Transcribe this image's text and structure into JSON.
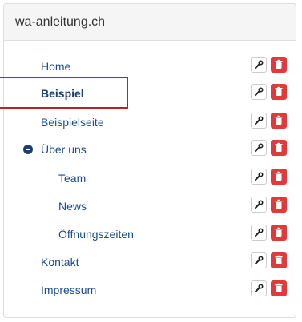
{
  "panel": {
    "title": "wa-anleitung.ch"
  },
  "pages": [
    {
      "label": "Home",
      "level": 1,
      "active": false
    },
    {
      "label": "Beispiel",
      "level": 1,
      "active": true
    },
    {
      "label": "Beispielseite",
      "level": 1,
      "active": false
    },
    {
      "label": "Über uns",
      "level": 1,
      "active": false,
      "expanded": true
    },
    {
      "label": "Team",
      "level": 2,
      "active": false
    },
    {
      "label": "News",
      "level": 2,
      "active": false
    },
    {
      "label": "Öffnungszeiten",
      "level": 2,
      "active": false
    },
    {
      "label": "Kontakt",
      "level": 1,
      "active": false
    },
    {
      "label": "Impressum",
      "level": 1,
      "active": false
    }
  ],
  "icons": {
    "edit": "wrench-icon",
    "delete": "trash-icon",
    "collapse": "minus-circle-icon"
  },
  "colors": {
    "link": "#1a4b8c",
    "delete": "#e23a3a",
    "highlight": "#b3262c"
  }
}
